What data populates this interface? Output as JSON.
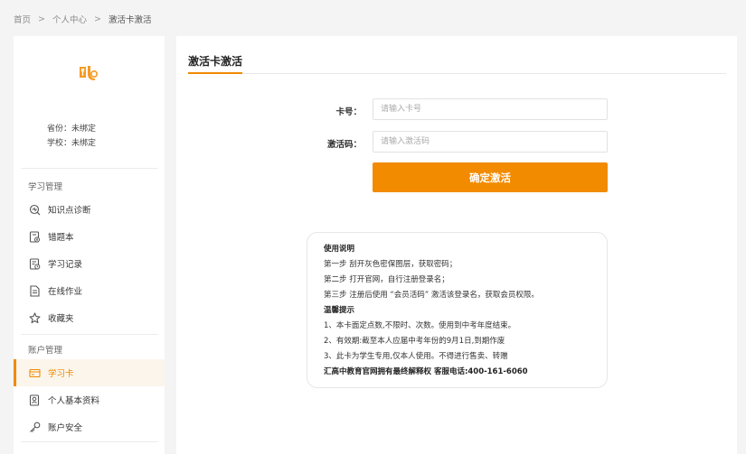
{
  "breadcrumb": {
    "home": "首页",
    "center": "个人中心",
    "current": "激活卡激活",
    "separator": ">"
  },
  "profile": {
    "province": "省份：未绑定",
    "school": "学校：未绑定"
  },
  "sidebar": {
    "study_section": "学习管理",
    "account_section": "账户管理",
    "study_items": [
      {
        "label": "知识点诊断",
        "icon": "diagnosis-icon"
      },
      {
        "label": "错题本",
        "icon": "wrong-book-icon"
      },
      {
        "label": "学习记录",
        "icon": "record-icon"
      },
      {
        "label": "在线作业",
        "icon": "homework-icon"
      },
      {
        "label": "收藏夹",
        "icon": "star-icon"
      }
    ],
    "account_items": [
      {
        "label": "学习卡",
        "icon": "card-icon",
        "active": true
      },
      {
        "label": "个人基本资料",
        "icon": "profile-icon"
      },
      {
        "label": "账户安全",
        "icon": "key-icon"
      }
    ]
  },
  "main": {
    "title": "激活卡激活",
    "card_label": "卡号：",
    "card_placeholder": "请输入卡号",
    "code_label": "激活码：",
    "code_placeholder": "请输入激活码",
    "submit_label": "确定激活"
  },
  "notice": {
    "heading": "使用说明",
    "steps": [
      "第一步 刮开灰色密保图层，获取密码；",
      "第二步 打开官网，自行注册登录名；",
      "第三步 注册后使用 “会员活码” 激活该登录名，获取会员权限。"
    ],
    "tips_heading": "温馨提示",
    "tips": [
      "1、本卡面定点数,不限时、次数。使用到中考年度结束。",
      "2、有效期:截至本人应届中考年份的9月1日,到期作废",
      "3、此卡为学生专用,仅本人使用。不得进行售卖、转赠"
    ],
    "footer": "汇高中教育官网拥有最终解释权 客服电话:400-161-6060"
  },
  "colors": {
    "accent": "#f28b00",
    "background": "#f4f4f4"
  }
}
